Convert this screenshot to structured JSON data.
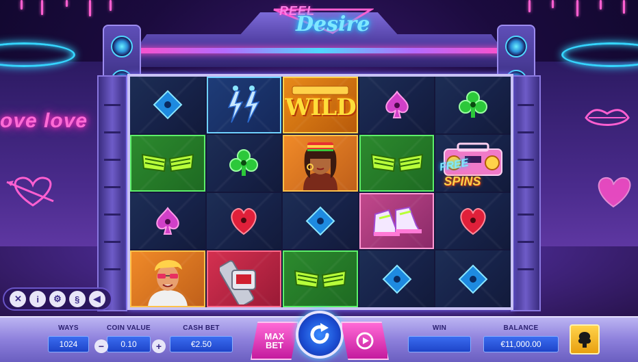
{
  "game": {
    "logo_line1": "REEL",
    "logo_line2": "Desire"
  },
  "decor": {
    "neon_text": "ove love"
  },
  "reels": {
    "wild_label": "WILD",
    "free_spins_line1": "FREE",
    "free_spins_line2": "SPINS",
    "rows": [
      [
        "diamond",
        "earrings",
        "wild",
        "spade",
        "club"
      ],
      [
        "glasses",
        "club",
        "woman-portrait",
        "glasses",
        "boombox-free-spins"
      ],
      [
        "spade",
        "heart",
        "diamond",
        "sneakers",
        "heart"
      ],
      [
        "man-portrait",
        "watch",
        "glasses",
        "diamond",
        "diamond"
      ]
    ]
  },
  "side_menu": {
    "buttons": [
      "close",
      "info",
      "settings",
      "rules",
      "sound"
    ],
    "glyphs": [
      "✕",
      "i",
      "⚙",
      "§",
      "◀"
    ]
  },
  "bottom_bar": {
    "ways_label": "WAYS",
    "ways_value": "1024",
    "coin_value_label": "COIN VALUE",
    "coin_value": "0.10",
    "coin_minus": "−",
    "coin_plus": "+",
    "cash_bet_label": "CASH BET",
    "cash_bet_value": "€2.50",
    "max_bet_line1": "MAX",
    "max_bet_line2": "BET",
    "win_label": "WIN",
    "win_value": "",
    "balance_label": "BALANCE",
    "balance_value": "€11,000.00"
  },
  "colors": {
    "accent_pink": "#ff4fc8",
    "accent_cyan": "#4fd8ff",
    "panel_blue": "#1e44c8"
  }
}
